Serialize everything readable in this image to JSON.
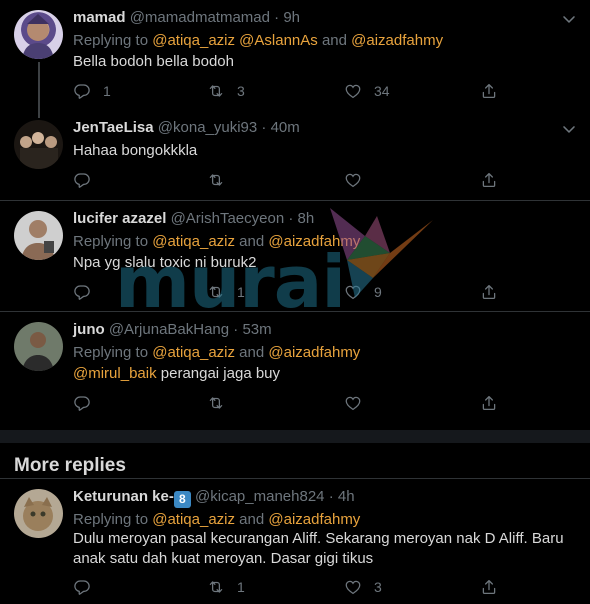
{
  "colors": {
    "background": "#000000",
    "mention": "#e8a33d",
    "muted": "#6e767d",
    "text": "#d9d9d9",
    "separator": "#2f3336",
    "keycap": "#3b88c3"
  },
  "tweets": [
    {
      "name": "mamad",
      "handle": "@mamadmatmamad",
      "time": "9h",
      "replying_label": "Replying to",
      "mentions": [
        "@atiqa_aziz",
        "@AslannAs",
        "@aizadfahmy"
      ],
      "text": "Bella bodoh bella bodoh",
      "counts": {
        "reply": "1",
        "retweet": "3",
        "like": "34"
      }
    },
    {
      "name": "JenTaeLisa",
      "handle": "@kona_yuki93",
      "time": "40m",
      "text": "Hahaa bongokkkla",
      "counts": {
        "reply": "",
        "retweet": "",
        "like": ""
      }
    },
    {
      "name": "lucifer azazel",
      "handle": "@ArishTaecyeon",
      "time": "8h",
      "replying_label": "Replying to",
      "mentions": [
        "@atiqa_aziz",
        "@aizadfahmy"
      ],
      "text": "Npa yg slalu toxic ni buruk2",
      "counts": {
        "reply": "",
        "retweet": "1",
        "like": "9"
      }
    },
    {
      "name": "juno",
      "handle": "@ArjunaBakHang",
      "time": "53m",
      "replying_label": "Replying to",
      "mentions": [
        "@atiqa_aziz",
        "@aizadfahmy"
      ],
      "text_mention": "@mirul_baik",
      "text": " perangai jaga buy",
      "counts": {
        "reply": "",
        "retweet": "",
        "like": ""
      }
    },
    {
      "name": "Keturunan ke-",
      "name_emoji": "8",
      "handle": "@kicap_maneh824",
      "time": "4h",
      "replying_label": "Replying to",
      "mentions": [
        "@atiqa_aziz",
        "@aizadfahmy"
      ],
      "text": "Dulu meroyan pasal kecurangan Aliff. Sekarang meroyan nak D Aliff. Baru anak satu dah kuat meroyan. Dasar gigi tikus",
      "counts": {
        "reply": "",
        "retweet": "1",
        "like": "3"
      }
    }
  ],
  "section": {
    "more_replies": "More replies"
  },
  "joiner": {
    "and": "and",
    "dot": "·"
  },
  "watermark": {
    "text": "murai"
  },
  "icons": [
    "reply-icon",
    "retweet-icon",
    "like-icon",
    "share-icon",
    "chevron-down-icon"
  ]
}
